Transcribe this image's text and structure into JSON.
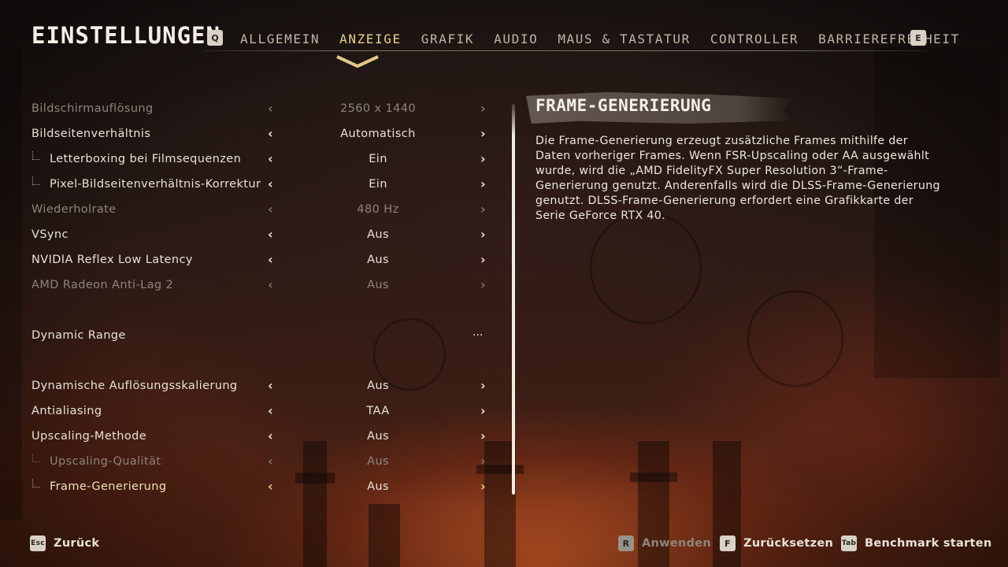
{
  "header": {
    "title": "EINSTELLUNGEN",
    "prev_key": "Q",
    "next_key": "E",
    "tabs": [
      {
        "label": "ALLGEMEIN"
      },
      {
        "label": "ANZEIGE"
      },
      {
        "label": "GRAFIK"
      },
      {
        "label": "AUDIO"
      },
      {
        "label": "MAUS & TASTATUR"
      },
      {
        "label": "CONTROLLER"
      },
      {
        "label": "BARRIEREFREIHEIT"
      }
    ],
    "active_tab": "ANZEIGE"
  },
  "settings": [
    {
      "label": "Bildschirmauflösung",
      "value": "2560 x 1440"
    },
    {
      "label": "Bildseitenverhältnis",
      "value": "Automatisch"
    },
    {
      "label": "Letterboxing bei Filmsequenzen",
      "value": "Ein"
    },
    {
      "label": "Pixel-Bildseitenverhältnis-Korrektur",
      "value": "Ein"
    },
    {
      "label": "Wiederholrate",
      "value": "480 Hz"
    },
    {
      "label": "VSync",
      "value": "Aus"
    },
    {
      "label": "NVIDIA Reflex Low Latency",
      "value": "Aus"
    },
    {
      "label": "AMD Radeon Anti-Lag 2",
      "value": "Aus"
    },
    {
      "label": "Dynamic Range",
      "value": "..."
    },
    {
      "label": "Dynamische Auflösungsskalierung",
      "value": "Aus"
    },
    {
      "label": "Antialiasing",
      "value": "TAA"
    },
    {
      "label": "Upscaling-Methode",
      "value": "Aus"
    },
    {
      "label": "Upscaling-Qualität",
      "value": "Aus"
    },
    {
      "label": "Frame-Generierung",
      "value": "Aus"
    }
  ],
  "info": {
    "title": "FRAME-GENERIERUNG",
    "description": "Die Frame-Generierung erzeugt zusätzliche Frames mithilfe der Daten vorheriger Frames. Wenn FSR-Upscaling oder AA ausgewählt wurde, wird die „AMD FidelityFX Super Resolution 3“-Frame-Generierung genutzt. Anderenfalls wird die DLSS-Frame-Generierung genutzt. DLSS-Frame-Generierung erfordert eine Grafikkarte der Serie GeForce RTX 40."
  },
  "footer": {
    "back": {
      "key": "Esc",
      "label": "Zurück"
    },
    "apply": {
      "key": "R",
      "label": "Anwenden"
    },
    "reset": {
      "key": "F",
      "label": "Zurücksetzen"
    },
    "benchmark": {
      "key": "Tab",
      "label": "Benchmark starten"
    }
  },
  "icons": {
    "left_arrow": "chevron-left-icon",
    "right_arrow": "chevron-right-icon",
    "tab_indicator": "chevron-down-icon",
    "sub_setting": "tree-branch-icon"
  },
  "colors": {
    "accent": "#e7cf8e",
    "text": "#e8e2d8",
    "disabled_text": "#8d847a"
  }
}
